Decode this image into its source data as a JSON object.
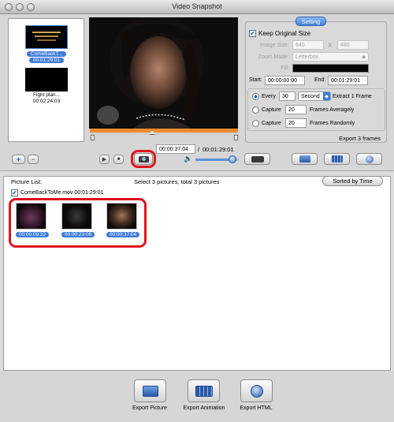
{
  "window": {
    "title": "Video Snapshot"
  },
  "videos": [
    {
      "name": "ComeBackT...",
      "duration": "00:01:29:01",
      "selected": true
    },
    {
      "name": "Fight plan...",
      "duration": "00:02:24:03",
      "selected": false
    }
  ],
  "player": {
    "current_time": "00:00:37:04",
    "separator": "/",
    "total_time": "00:01:29:01",
    "volume_level": 0.85
  },
  "settings": {
    "tab_label": "Setting",
    "keep_original_size_label": "Keep Original Size",
    "keep_original_size_checked": true,
    "image_size_label": "Image Size:",
    "width": "640",
    "x_label": "X",
    "height": "480",
    "zoom_mode_label": "Zoom Mode:",
    "zoom_mode_value": "Letterbox",
    "fill_label": "Fill:",
    "start_label": "Start:",
    "start_value": "00:00:00:00",
    "end_label": "End:",
    "end_value": "00:01:29:01",
    "every_label": "Every",
    "every_value": "30",
    "every_unit": "Second",
    "every_suffix": "Extract 1 Frame",
    "capture_label": "Capture",
    "capture_avg_value": "20",
    "capture_avg_suffix": "Frames Averagely",
    "capture_rand_value": "20",
    "capture_rand_suffix": "Frames Randomly",
    "export_count": "Export 3 frames"
  },
  "picture_list": {
    "label": "Picture List:",
    "summary": "Select 3 pictures, total 3 pictures",
    "sort_button": "Sorted by Time",
    "group_title": "ComeBackToMe.mov 00:01:29:01",
    "pictures": [
      {
        "time": "00:00:09:22"
      },
      {
        "time": "00:00:23:06"
      },
      {
        "time": "00:00:37:04"
      }
    ]
  },
  "export": {
    "picture_label": "Export Picture",
    "animation_label": "Export Animation",
    "html_label": "Export HTML"
  },
  "controls": {
    "add_symbol": "+",
    "remove_symbol": "−",
    "play_symbol": "▶",
    "stop_symbol": "■",
    "volume_symbol": "🔈",
    "checkmark": "✔"
  },
  "colors": {
    "selection_blue": "#3d7bd8",
    "highlight_red": "#e0131e",
    "progress_orange": "#f08a2c"
  }
}
